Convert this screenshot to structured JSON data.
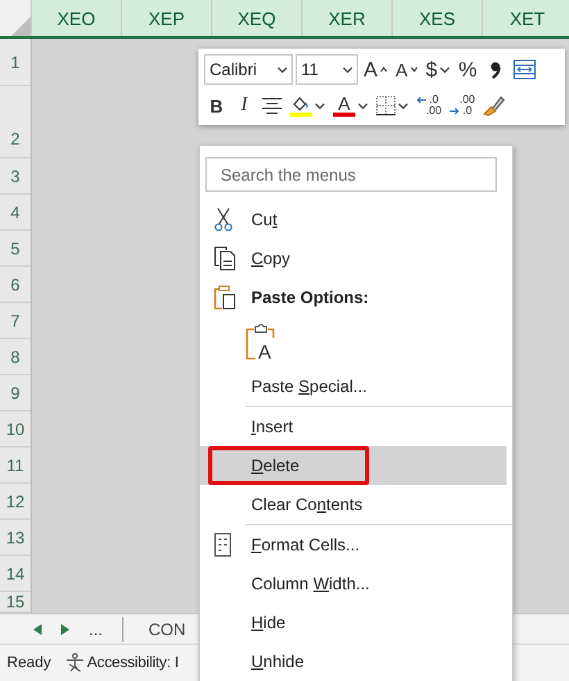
{
  "sheet": {
    "columns": [
      {
        "label": "XEO",
        "selected": true
      },
      {
        "label": "XEP",
        "selected": true
      },
      {
        "label": "XEQ",
        "selected": true
      },
      {
        "label": "XER",
        "selected": true
      },
      {
        "label": "XES",
        "selected": true
      },
      {
        "label": "XET",
        "selected": true
      }
    ],
    "rows": [
      "1",
      "2",
      "3",
      "4",
      "5",
      "6",
      "7",
      "8",
      "9",
      "10",
      "11",
      "12",
      "13",
      "14",
      "15"
    ]
  },
  "sheet_tabs": {
    "more": "...",
    "tabs": [
      "CON"
    ]
  },
  "status_bar": {
    "mode": "Ready",
    "accessibility": "Accessibility: I"
  },
  "mini_toolbar": {
    "font": "Calibri",
    "size": "11",
    "row1": [
      {
        "kind": "grow",
        "glyph": "A"
      },
      {
        "kind": "shrink",
        "glyph": "A"
      },
      {
        "kind": "currency",
        "glyph": "$",
        "dropdown": true
      },
      {
        "kind": "percent",
        "glyph": "%"
      },
      {
        "kind": "comma"
      },
      {
        "kind": "wrap"
      }
    ],
    "row2": [
      {
        "kind": "bold",
        "glyph": "B"
      },
      {
        "kind": "italic",
        "glyph": "I"
      },
      {
        "kind": "center"
      },
      {
        "kind": "fill",
        "color": "#ffff00",
        "dropdown": true
      },
      {
        "kind": "font-color",
        "glyph": "A",
        "color": "#e00000",
        "dropdown": true
      },
      {
        "kind": "borders",
        "dropdown": true
      },
      {
        "kind": "increase-decimal",
        "top": ".0",
        "bottom": ".00"
      },
      {
        "kind": "decrease-decimal",
        "top": ".00",
        "bottom": ".0"
      },
      {
        "kind": "painter"
      }
    ]
  },
  "menu": {
    "search": {
      "placeholder": "Search the menus"
    },
    "items": [
      {
        "kind": "cut",
        "pre": "Cu",
        "key": "t",
        "selected": false
      },
      {
        "kind": "copy",
        "key": "C",
        "post": "opy",
        "selected": false
      },
      {
        "kind": "header",
        "label": "Paste Options:"
      },
      {
        "kind": "paste-icons",
        "glyph": "A"
      },
      {
        "kind": "command",
        "pre": "Paste ",
        "key": "S",
        "post": "pecial...",
        "selected": false
      },
      {
        "kind": "separator"
      },
      {
        "kind": "command",
        "key": "I",
        "post": "nsert",
        "selected": false
      },
      {
        "kind": "command",
        "key": "D",
        "post": "elete",
        "selected": true,
        "outlined": true
      },
      {
        "kind": "command",
        "pre": "Clear Co",
        "key": "n",
        "post": "tents",
        "selected": false
      },
      {
        "kind": "separator"
      },
      {
        "kind": "format",
        "key": "F",
        "post": "ormat Cells...",
        "selected": false
      },
      {
        "kind": "command",
        "pre": "Column ",
        "key": "W",
        "post": "idth...",
        "selected": false
      },
      {
        "kind": "command",
        "key": "H",
        "post": "ide",
        "selected": false
      },
      {
        "kind": "command",
        "key": "U",
        "post": "nhide",
        "selected": false
      }
    ]
  }
}
